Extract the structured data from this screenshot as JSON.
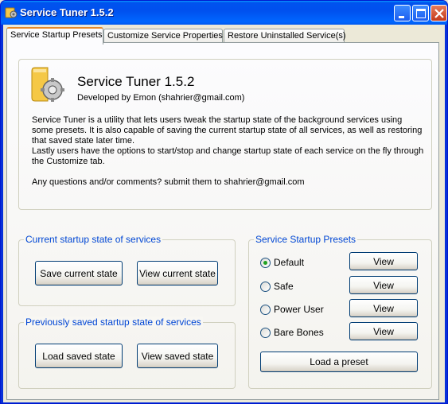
{
  "window": {
    "title": "Service Tuner 1.5.2"
  },
  "tabs": [
    {
      "label": "Service Startup Presets",
      "active": true
    },
    {
      "label": "Customize Service Properties",
      "active": false
    },
    {
      "label": "Restore Uninstalled Service(s)",
      "active": false
    }
  ],
  "about": {
    "app_name": "Service Tuner 1.5.2",
    "developer": "Developed  by  Emon (shahrier@gmail.com)",
    "description_lines": [
      "Service Tuner is a utility that lets users tweak the startup state of the background services using",
      "some presets. It is also capable of saving the current startup state of all services,  as well as restoring",
      "that saved state later time.",
      "Lastly users have the options to start/stop and change startup state of each service on the fly through",
      "the Customize tab."
    ],
    "contact": "Any questions and/or comments? submit them to shahrier@gmail.com"
  },
  "current_state": {
    "title": "Current startup state of services",
    "save_label": "Save current state",
    "view_label": "View current state"
  },
  "saved_state": {
    "title": "Previously saved startup state of services",
    "load_label": "Load saved state",
    "view_label": "View saved state"
  },
  "presets": {
    "title": "Service Startup Presets",
    "items": [
      {
        "label": "Default",
        "selected": true,
        "view_label": "View"
      },
      {
        "label": "Safe",
        "selected": false,
        "view_label": "View"
      },
      {
        "label": "Power User",
        "selected": false,
        "view_label": "View"
      },
      {
        "label": "Bare Bones",
        "selected": false,
        "view_label": "View"
      }
    ],
    "load_label": "Load a preset"
  },
  "icons": {
    "app": "gear-folder-icon",
    "minimize": "minimize-icon",
    "maximize": "maximize-icon",
    "close": "close-icon"
  },
  "colors": {
    "titlebar": "#0058ee",
    "group_title": "#0046d5",
    "tab_highlight": "#e68b2c",
    "radio_dot": "#21a121"
  }
}
